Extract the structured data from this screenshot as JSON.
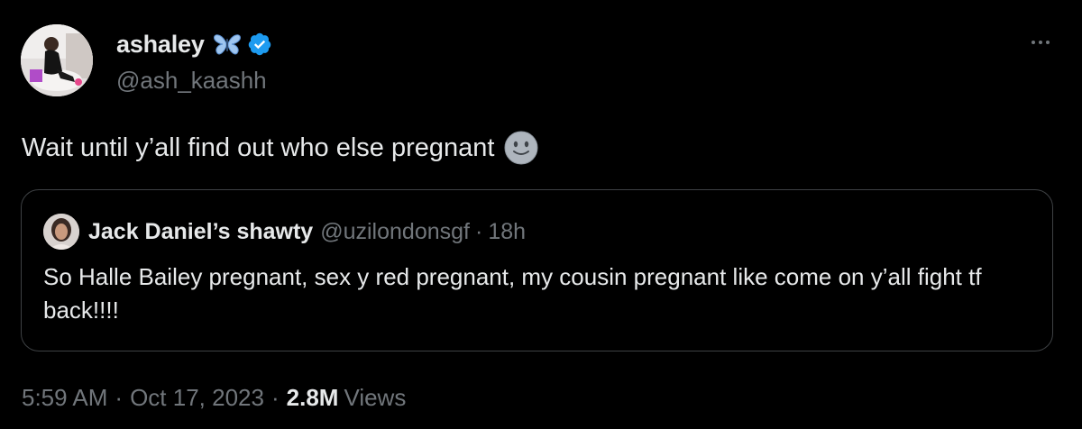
{
  "author": {
    "display_name": "ashaley",
    "handle": "@ash_kaashh",
    "icons": [
      "butterfly-icon",
      "verified-badge-icon"
    ]
  },
  "tweet": {
    "text": "Wait until y’all find out who else pregnant",
    "emoji_icon": "slightly-smiling-face-icon"
  },
  "quote": {
    "display_name": "Jack Daniel’s shawty",
    "handle": "@uzilondonsgf",
    "separator": "·",
    "time": "18h",
    "text": "So Halle Bailey pregnant, sex y red pregnant, my cousin pregnant like come on y’all fight tf back!!!!"
  },
  "meta": {
    "time": "5:59 AM",
    "separator": "·",
    "date": "Oct 17, 2023",
    "views_count": "2.8M",
    "views_label": "Views"
  },
  "colors": {
    "background": "#000000",
    "text_primary": "#e7e9ea",
    "text_secondary": "#71767b",
    "verified_blue": "#1d9bf0",
    "border": "#3e4144"
  }
}
